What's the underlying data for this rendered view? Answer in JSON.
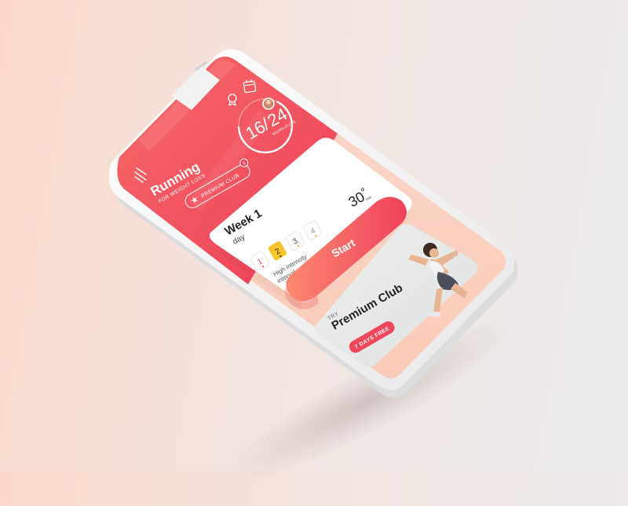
{
  "app": {
    "title": "Running",
    "subtitle": "FOR WEIGHT LOSS",
    "premium_badge_label": "PREMIUM CLUB",
    "premium_badge_count": "3"
  },
  "header_icons": {
    "medal": "medal-icon",
    "calendar": "calendar-icon",
    "avatar": "avatar"
  },
  "progress": {
    "done": "16",
    "separator": "/",
    "total": "24",
    "label": "WORKOUTS",
    "fraction": 0.667
  },
  "workout_card": {
    "week_label": "Week 1",
    "day_label": "day",
    "days": [
      {
        "label": "1",
        "state": "done"
      },
      {
        "label": "2",
        "state": "active"
      },
      {
        "label": "3",
        "state": "upcoming"
      },
      {
        "label": "4",
        "state": "upcoming"
      }
    ],
    "description_line1": "High intencity",
    "description_line2": "interval workout",
    "duration_value": "30",
    "duration_unit": "min",
    "start_button": "Start"
  },
  "promo_card": {
    "try_label": "TRY",
    "title": "Premium Club",
    "cta": "7 DAYS FREE"
  },
  "colors": {
    "accent": "#f0465a",
    "accent_light": "#fb7d6e",
    "active_day": "#f6c42b",
    "background_left": "#f9d8cb",
    "background_right": "#ececee"
  }
}
